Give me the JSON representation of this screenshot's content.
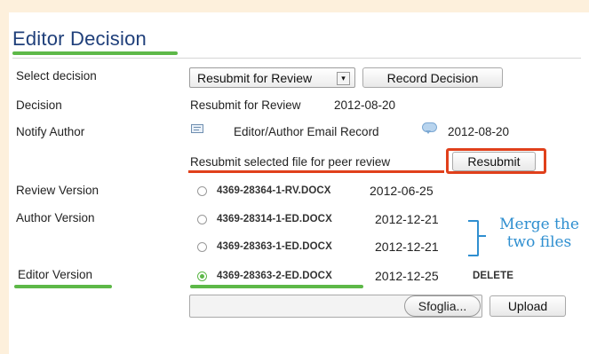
{
  "page": {
    "title": "Editor Decision"
  },
  "rows": {
    "select_decision": {
      "label": "Select decision",
      "selected": "Resubmit for Review",
      "button": "Record Decision"
    },
    "decision": {
      "label": "Decision",
      "value": "Resubmit for Review",
      "date": "2012-08-20"
    },
    "notify_author": {
      "label": "Notify Author",
      "link": "Editor/Author Email Record",
      "date": "2012-08-20"
    },
    "resubmit": {
      "text": "Resubmit selected file for peer review",
      "button": "Resubmit"
    },
    "review_version": {
      "label": "Review Version",
      "file": "4369-28364-1-RV.DOCX",
      "date": "2012-06-25"
    },
    "author_version": {
      "label": "Author Version",
      "files": [
        {
          "file": "4369-28314-1-ED.DOCX",
          "date": "2012-12-21"
        },
        {
          "file": "4369-28363-1-ED.DOCX",
          "date": "2012-12-21"
        }
      ]
    },
    "editor_version": {
      "label": "Editor Version",
      "file": "4369-28363-2-ED.DOCX",
      "date": "2012-12-25",
      "delete": "DELETE"
    },
    "upload": {
      "browse": "Sfoglia...",
      "button": "Upload"
    }
  },
  "annotation": {
    "note_line1": "Merge the",
    "note_line2": "two files"
  },
  "colors": {
    "highlight_green": "#5db848",
    "highlight_red": "#e0401b",
    "note_blue": "#2f8fd0",
    "title_blue": "#1f3f7a"
  }
}
